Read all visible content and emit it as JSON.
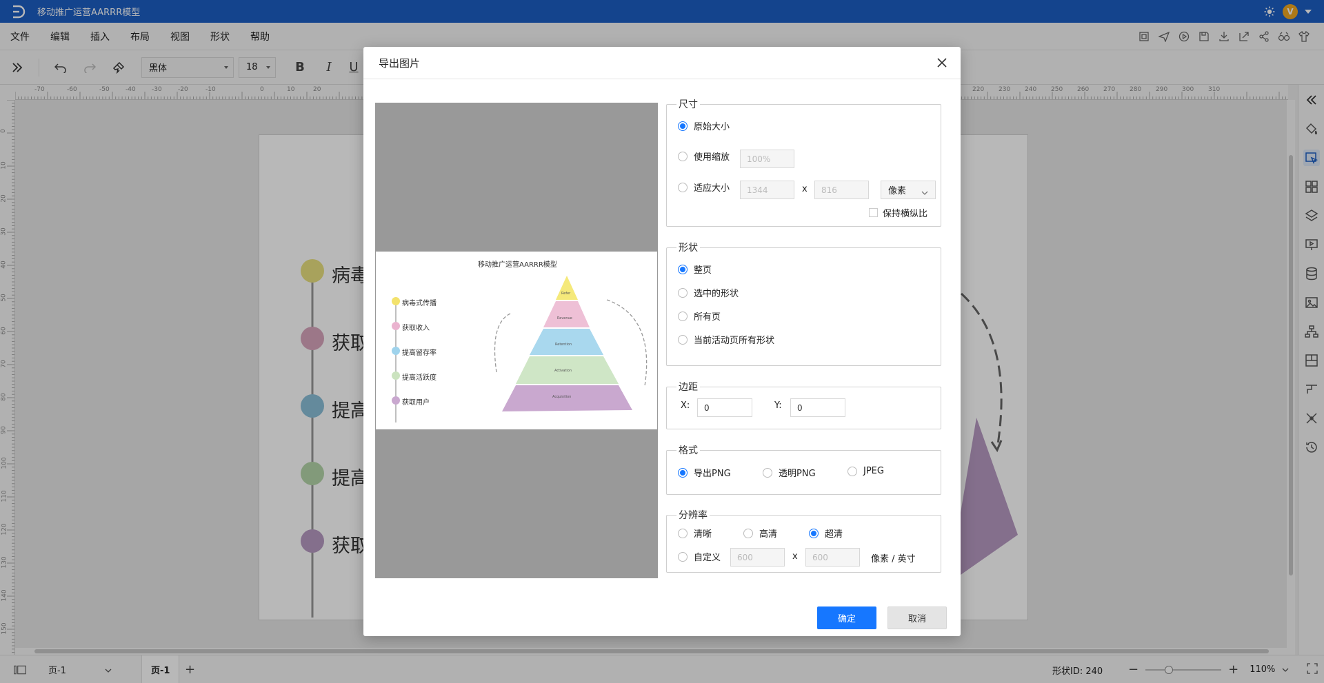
{
  "app": {
    "title": "移动推广运营AARRR模型"
  },
  "menu": {
    "items": [
      "文件",
      "编辑",
      "插入",
      "布局",
      "视图",
      "形状",
      "帮助"
    ]
  },
  "toolbar": {
    "font_family": "黑体",
    "font_size": "18",
    "bold_label": "B",
    "italic_label": "I",
    "underline_label": "U"
  },
  "ruler": {
    "h_labels": [
      "-70",
      "-60",
      "-50",
      "-40",
      "-30",
      "-20",
      "-10",
      "0",
      "10",
      "20",
      "220",
      "230",
      "240",
      "250",
      "260",
      "270",
      "280",
      "290",
      "300",
      "310"
    ],
    "v_labels": [
      "0",
      "10",
      "20",
      "30",
      "40",
      "50",
      "60",
      "70",
      "80",
      "90",
      "100",
      "110",
      "120",
      "130",
      "140",
      "150"
    ]
  },
  "canvas": {
    "timeline": [
      {
        "label": "病毒",
        "color": "#e9e180"
      },
      {
        "label": "获取",
        "color": "#d9a6bd"
      },
      {
        "label": "提高",
        "color": "#8bbfd9"
      },
      {
        "label": "提高",
        "color": "#b5d6a9"
      },
      {
        "label": "获取",
        "color": "#b89ac3"
      }
    ]
  },
  "dialog": {
    "title": "导出图片",
    "preview": {
      "title": "移动推广运营AARRR模型",
      "items": [
        {
          "label": "病毒式传播",
          "color": "#f3e26c"
        },
        {
          "label": "获取收入",
          "color": "#eab3cf"
        },
        {
          "label": "提高留存率",
          "color": "#9fd3ec"
        },
        {
          "label": "提高活跃度",
          "color": "#cbe3bf"
        },
        {
          "label": "获取用户",
          "color": "#c9a8cf"
        }
      ],
      "pyramid": [
        {
          "label": "Refer",
          "color": "#f5e97a"
        },
        {
          "label": "Revenue",
          "color": "#eec0d6"
        },
        {
          "label": "Retention",
          "color": "#a9d8ee"
        },
        {
          "label": "Activation",
          "color": "#cfe6c6"
        },
        {
          "label": "Acquisition",
          "color": "#c9a8cf"
        }
      ]
    },
    "size": {
      "legend": "尺寸",
      "original": "原始大小",
      "scale": "使用缩放",
      "scale_value": "100%",
      "fit": "适应大小",
      "fit_width": "1344",
      "times": "x",
      "fit_height": "816",
      "unit": "像素",
      "keep_ratio": "保持横纵比"
    },
    "shape": {
      "legend": "形状",
      "options": [
        "整页",
        "选中的形状",
        "所有页",
        "当前活动页所有形状"
      ]
    },
    "margin": {
      "legend": "边距",
      "x_label": "X:",
      "x_value": "0",
      "y_label": "Y:",
      "y_value": "0"
    },
    "format": {
      "legend": "格式",
      "options": [
        "导出PNG",
        "透明PNG",
        "JPEG"
      ]
    },
    "resolution": {
      "legend": "分辨率",
      "options": [
        "清晰",
        "高清",
        "超清"
      ],
      "custom": "自定义",
      "custom_w": "600",
      "times": "x",
      "custom_h": "600",
      "unit": "像素 / 英寸"
    },
    "ok": "确定",
    "cancel": "取消"
  },
  "status": {
    "page_select": "页-1",
    "page_tab": "页-1",
    "add": "+",
    "shape_id": "形状ID: 240",
    "zoom": "110%"
  }
}
